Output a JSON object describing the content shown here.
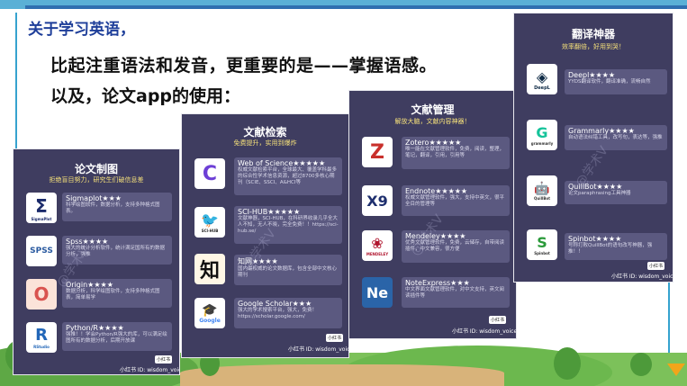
{
  "heading": {
    "line1": "关于学习英语，",
    "line2": "比起注重语法和发音，更重要的是——掌握语感。",
    "line3": "以及，论文app的使用："
  },
  "cards": [
    {
      "title": "论文制图",
      "subtitle": "拒绝盲目努力，研究生们破信息差",
      "footer": "小红书 ID: wisdom_voice",
      "tag": "小红书",
      "items": [
        {
          "icon": "sigmaplot-logo",
          "logo_text": "Σ",
          "logo_sub": "SigmaPlot",
          "name": "Sigmaplot★★★",
          "desc": "科学绘图软件，数据分析，支持多种格式图表。"
        },
        {
          "icon": "spss-logo",
          "logo_text": "SPSS",
          "logo_sub": "",
          "name": "Spss★★★★",
          "desc": "强大的统计分析软件，统计满足国所有的数据分析，强推"
        },
        {
          "icon": "origin-logo",
          "logo_text": "O",
          "logo_sub": "",
          "name": "Origin★★★★",
          "desc": "数据分析，科学绘图软件，支持多种格式图表，简单易学"
        },
        {
          "icon": "rstudio-logo",
          "logo_text": "R",
          "logo_sub": "RStudio",
          "name": "Python/R★★★★",
          "desc": "强推！！学会Python/R强大的库，可以满足绘图所有的数据分析，后期开放课"
        }
      ]
    },
    {
      "title": "文献检索",
      "subtitle": "免费提升，实用到爆炸",
      "footer": "小红书 ID: wisdom_voice",
      "tag": "小红书",
      "items": [
        {
          "icon": "web-of-science-logo",
          "logo_text": "C",
          "logo_sub": "",
          "name": "Web of Science★★★★★",
          "desc": "权威文献检索平台，全球最大、覆盖学科最多的综合性学术信息资源，超过8700多核心期刊（SCIE、SSCI、A&HCI等"
        },
        {
          "icon": "sci-hub-logo",
          "logo_text": "🐦",
          "logo_sub": "SCI-HUB",
          "name": "SCI-HUB★★★★★",
          "desc": "文献神器，SCI-HUB，在科研界收录几乎全大人不知，无人不晓，完全免费！！https://sci-hub.se/"
        },
        {
          "icon": "zhiwang-logo",
          "logo_text": "知",
          "logo_sub": "",
          "name": "知网★★★★",
          "desc": "国内最权威的论文数据库，包含全部中文核心期刊"
        },
        {
          "icon": "google-scholar-logo",
          "logo_text": "🎓",
          "logo_sub": "Google",
          "name": "Google Scholar★★★",
          "desc": "强大的学术搜索平台，强大，免费！https://scholar.google.com/"
        }
      ]
    },
    {
      "title": "文献管理",
      "subtitle": "解放大脑，文献内容神器！",
      "footer": "小红书 ID: wisdom_voice",
      "tag": "小红书",
      "items": [
        {
          "icon": "zotero-logo",
          "logo_text": "Z",
          "logo_sub": "",
          "name": "Zotero★★★★★",
          "desc": "唯一能在文献管理软件，免费，阅读，整理，笔记，翻译，引用，引用等"
        },
        {
          "icon": "endnote-logo",
          "logo_text": "X9",
          "logo_sub": "",
          "name": "Endnote★★★★★",
          "desc": "权威文献管理软件，强大，支持中英文，很平全目的管理等"
        },
        {
          "icon": "mendeley-logo",
          "logo_text": "❀",
          "logo_sub": "MENDELEY",
          "name": "Mendeley★★★★",
          "desc": "优秀文献管理软件，免费，云储存，自带阅读插件，中文兼容，很方便"
        },
        {
          "icon": "noteexpress-logo",
          "logo_text": "Ne",
          "logo_sub": "",
          "name": "NoteExpress★★★",
          "desc": "中文界面文献管理软件，对中文支持，英文阅读插件等"
        }
      ]
    },
    {
      "title": "翻译神器",
      "subtitle": "效率翻倍，好用到哭！",
      "footer": "小红书 ID: wisdom_voice",
      "tag": "小红书",
      "items": [
        {
          "icon": "deepl-logo",
          "logo_text": "◈",
          "logo_sub": "DeepL",
          "name": "Deepl★★★★",
          "desc": "YYDS翻译软件，翻译准确，流畅自然"
        },
        {
          "icon": "grammarly-logo",
          "logo_text": "G",
          "logo_sub": "grammarly",
          "name": "Grammarly★★★★",
          "desc": "自动语法纠错工具，改写句，表达等，强推"
        },
        {
          "icon": "quillbot-logo",
          "logo_text": "🤖",
          "logo_sub": "QuillBot",
          "name": "QuillBot★★★★",
          "desc": "论文paraphrasing工具神器"
        },
        {
          "icon": "spinbot-logo",
          "logo_text": "S",
          "logo_sub": "Spinbot",
          "name": "Spinbot★★★★",
          "desc": "号称打败QuillBot的语句改写神器，强推！！"
        }
      ]
    }
  ],
  "watermark": "@学术V"
}
